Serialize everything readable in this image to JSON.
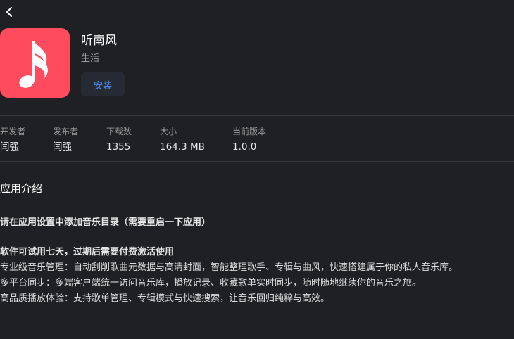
{
  "header": {
    "back_icon": "chevron-left-icon"
  },
  "app": {
    "name": "听南风",
    "category": "生活",
    "icon": "music-note-icon",
    "icon_color": "#fe4b5e",
    "install_label": "安装"
  },
  "info": [
    {
      "label": "开发者",
      "value": "闫强"
    },
    {
      "label": "发布者",
      "value": "闫强"
    },
    {
      "label": "下载数",
      "value": "1355"
    },
    {
      "label": "大小",
      "value": "164.3 MB"
    },
    {
      "label": "当前版本",
      "value": "1.0.0"
    }
  ],
  "intro": {
    "title": "应用介绍",
    "notice": "请在应用设置中添加音乐目录（需要重启一下应用）",
    "trial": "软件可试用七天，过期后需要付费激活使用",
    "features": [
      "专业级音乐管理：自动刮削歌曲元数据与高清封面，智能整理歌手、专辑与曲风，快速搭建属于你的私人音乐库。",
      "多平台同步：多端客户端统一访问音乐库，播放记录、收藏歌单实时同步，随时随地继续你的音乐之旅。",
      "高品质播放体验：支持歌单管理、专辑模式与快速搜索，让音乐回归纯粹与高效。"
    ]
  },
  "colors": {
    "background": "#1f2023",
    "accent": "#4d8bf0",
    "button_bg": "#252a33"
  }
}
